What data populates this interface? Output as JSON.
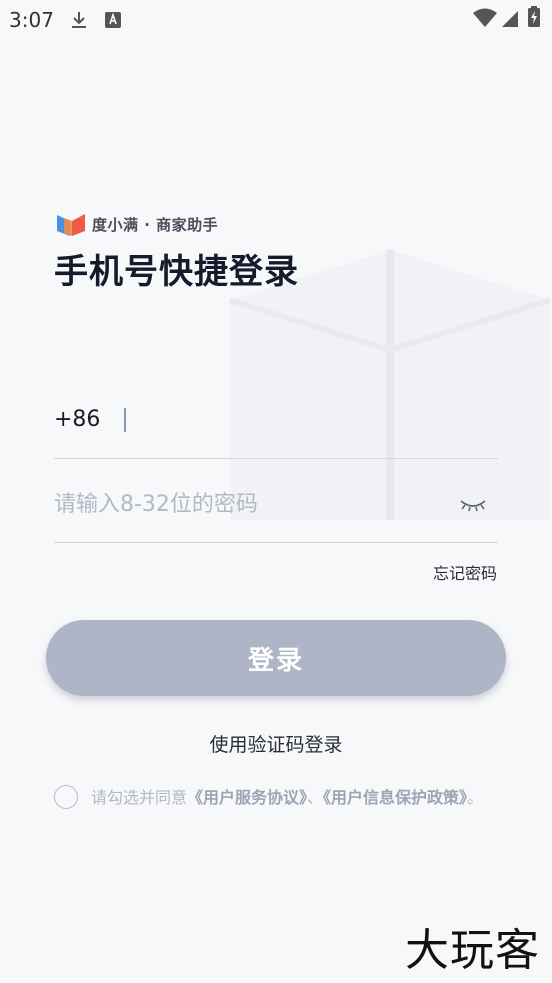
{
  "status_bar": {
    "time": "3:07",
    "icons": [
      "download-icon",
      "keyboard-icon",
      "wifi-icon",
      "signal-icon",
      "battery-icon"
    ]
  },
  "brand": {
    "name": "度小满 · 商家助手",
    "logo_colors": [
      "#4a90e2",
      "#f05a4a"
    ]
  },
  "login": {
    "title": "手机号快捷登录",
    "country_code": "+86",
    "phone_value": "",
    "password_placeholder": "请输入8-32位的密码",
    "password_toggle_icon": "eye-closed-icon",
    "forgot_password": "忘记密码",
    "login_button": "登录",
    "code_login": "使用验证码登录"
  },
  "agreement": {
    "prefix": "请勾选并同意",
    "service_agreement": "《用户服务协议》",
    "separator": "、",
    "privacy_policy": "《用户信息保护政策》",
    "suffix": "。"
  },
  "watermark": {
    "text": "大玩客"
  },
  "colors": {
    "background": "#f7f8fa",
    "button_disabled": "#aeb5c7",
    "placeholder": "#b3b8c5",
    "title": "#161a2a"
  }
}
